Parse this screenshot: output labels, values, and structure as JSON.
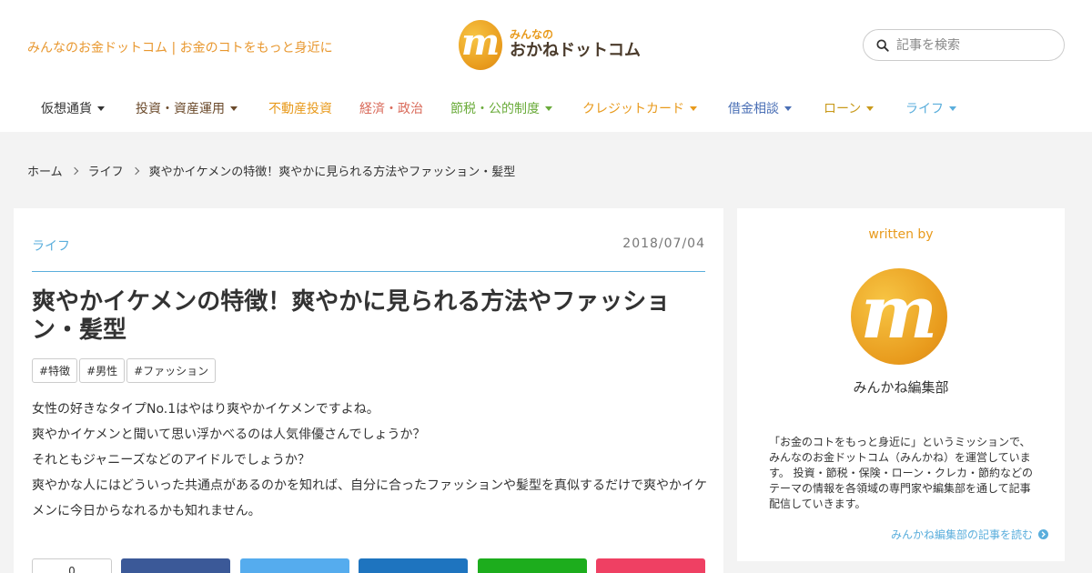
{
  "header": {
    "tagline": "みんなのお金ドットコム | お金のコトをもっと身近に",
    "logo_mark": "m",
    "logo_small": "みんなの",
    "logo_big": "おかねドットコム"
  },
  "search": {
    "placeholder": "記事を検索",
    "icon": "search-icon"
  },
  "nav": [
    {
      "label": "仮想通貨",
      "color": "#333333",
      "has_caret": true
    },
    {
      "label": "投資・資産運用",
      "color": "#6b4a2b",
      "has_caret": true
    },
    {
      "label": "不動産投資",
      "color": "#e89a1c",
      "has_caret": false
    },
    {
      "label": "経済・政治",
      "color": "#d96a5a",
      "has_caret": false
    },
    {
      "label": "節税・公的制度",
      "color": "#6aab3a",
      "has_caret": true
    },
    {
      "label": "クレジットカード",
      "color": "#e89a1c",
      "has_caret": true
    },
    {
      "label": "借金相談",
      "color": "#4a6fb5",
      "has_caret": true
    },
    {
      "label": "ローン",
      "color": "#c99a1c",
      "has_caret": true
    },
    {
      "label": "ライフ",
      "color": "#5aaedc",
      "has_caret": true
    }
  ],
  "breadcrumb": [
    "ホーム",
    "ライフ",
    "爽やかイケメンの特徴！爽やかに見られる方法やファッション・髪型"
  ],
  "article": {
    "category": "ライフ",
    "date": "2018/07/04",
    "title": "爽やかイケメンの特徴！爽やかに見られる方法やファッション・髪型",
    "tags": [
      "#特徴",
      "#男性",
      "#ファッション"
    ],
    "paragraphs": [
      "女性の好きなタイプNo.1はやはり爽やかイケメンですよね。",
      "爽やかイケメンと聞いて思い浮かべるのは人気俳優さんでしょうか？",
      "それともジャニーズなどのアイドルでしょうか？",
      "爽やかな人にはどういった共通点があるのかを知れば、自分に合ったファッションや髪型を真似するだけで爽やかイケメンに今日からなれるかも知れません。"
    ],
    "share_count": "0",
    "share_colors": [
      "#3b5998",
      "#55acee",
      "#1e74bf",
      "#1dad1d",
      "#ef4063"
    ]
  },
  "sidebar": {
    "written_by": "written by",
    "avatar_mark": "m",
    "author": "みんかね編集部",
    "bio": "「お金のコトをもっと身近に」というミッションで、みんなのお金ドットコム（みんかね）を運営しています。 投資・節税・保険・ローン・クレカ・節約などのテーマの情報を各領域の専門家や編集部を通して記事配信していきます。",
    "more": "みんかね編集部の記事を読む"
  }
}
